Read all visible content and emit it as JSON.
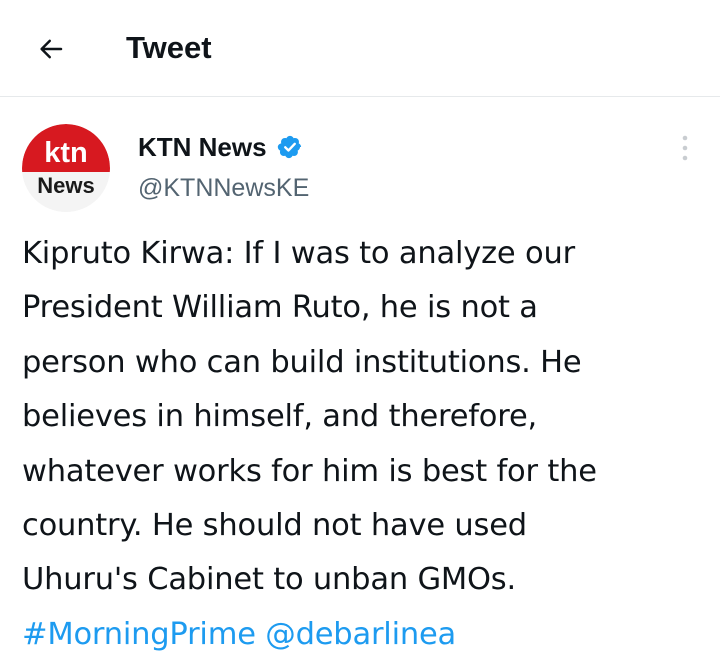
{
  "header": {
    "back_icon": "arrow-left-icon",
    "title": "Tweet"
  },
  "tweet": {
    "author": {
      "name": "KTN News",
      "handle": "@KTNNewsKE",
      "verified_icon": "verified-badge-icon",
      "avatar": {
        "logo_top": "ktn",
        "logo_bottom": "News",
        "brand_color": "#d71920"
      }
    },
    "more_icon": "more-vertical-icon",
    "text_lines": [
      "Kipruto Kirwa: If I was to analyze our",
      "President William Ruto, he is not a",
      "person who can build institutions. He",
      "believes in himself, and therefore,",
      "whatever works for him is best for the",
      "country. He should not have used",
      "Uhuru's Cabinet to unban GMOs."
    ],
    "hashtag": "#MorningPrime",
    "mention": "@debarlinea"
  },
  "colors": {
    "link": "#1d9bf0",
    "text": "#0f1419",
    "secondary_text": "#536471",
    "divider": "#e6e9eb"
  }
}
